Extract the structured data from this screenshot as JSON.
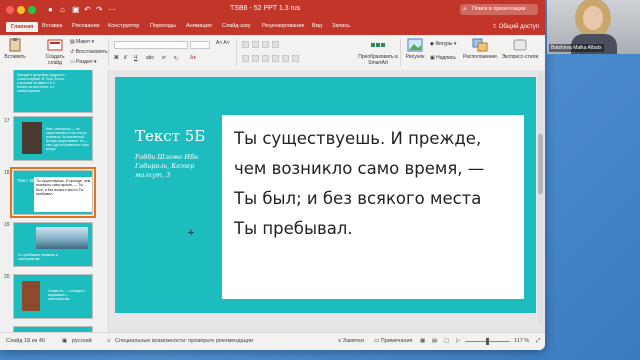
{
  "window": {
    "title": "TSB6 - 52 PPT 1.3 rus",
    "search_placeholder": "Поиск в презентации"
  },
  "ribbon_tabs": [
    "Главная",
    "Вставка",
    "Рисование",
    "Конструктор",
    "Переходы",
    "Анимация",
    "Слайд-шоу",
    "Рецензирование",
    "Вид",
    "Запись"
  ],
  "share_label": "Общий доступ",
  "ribbon": {
    "paste": "Вставить",
    "new_slide": "Создать слайд",
    "layout": "Макет",
    "reset": "Восстановить",
    "section": "Раздел",
    "smartart": "Преобразовать в SmartArt",
    "picture": "Рисунок",
    "shapes": "Фигуры",
    "textbox": "Надпись",
    "arrange": "Расположение",
    "quick_styles": "Экспресс-стили"
  },
  "thumbnails": [
    {
      "num": "",
      "title": "",
      "body": "Прежде в депутатах мудрость только первые, В Тора, Богия, и во всем на свете и и у бытия, во все сенят, и с любых времен"
    },
    {
      "num": "17",
      "title": "",
      "body": "Или: глаголешь — не существовал, и вот потом возникло. Во вселенной. Всегда существовал Ты — там, где исчерпаются и все концы"
    },
    {
      "num": "18",
      "title": "Текст 5Б",
      "body": "Ты существуешь. И прежде, чем возникло само время, — Ты был; и без всякого места Ты пребывал."
    },
    {
      "num": "19",
      "title": "",
      "body": "Б-г пребывает времени и пространства"
    },
    {
      "num": "20",
      "title": "",
      "body": "Схемы В-г — словари с видимыми — пространство"
    }
  ],
  "slide": {
    "title": "Текст 5Б",
    "subtitle": "Рабби Шломо Ибн Габироль, Кетер малхут, 3",
    "body_lines": [
      "Ты существуешь. И прежде,",
      "чем возникло само время, —",
      "Ты был; и без всякого места",
      "Ты пребывал."
    ]
  },
  "status": {
    "slide_of": "Слайд 18 из 40",
    "language": "русский",
    "accessibility": "Специальные возможности: проверьте рекомендации",
    "notes": "Заметки",
    "comments": "Примечания",
    "zoom": "117 %"
  },
  "webcam": {
    "name": "Batsheva Malka Albats"
  },
  "colors": {
    "accent": "#c2362a",
    "slide_teal": "#1dbcbf",
    "selection": "#e2741f"
  }
}
